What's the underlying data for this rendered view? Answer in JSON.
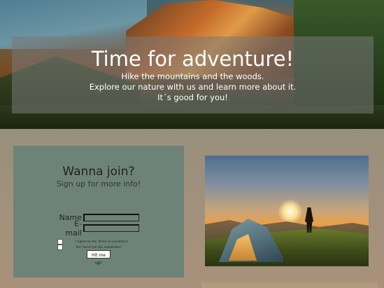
{
  "hero": {
    "title": "Time for adventure!",
    "lines": [
      "Hike the mountains and the woods.",
      "Explore our nature with us and learn more about it.",
      "It´s good for you!"
    ]
  },
  "join": {
    "title": "Wanna join?",
    "subtitle": "Sign up for more info!",
    "name_label": "Name",
    "email_label": "E-mail",
    "name_value": "",
    "email_value": "",
    "terms_label": "I agree to the Terms & Conditions",
    "newsletter_label": "Yes! Send me the newsletter!",
    "submit_label": "Hit me up!"
  },
  "colors": {
    "panel": "#6e8378",
    "overlay": "rgba(120,120,120,0.55)"
  },
  "icons": {
    "hero_image": "mountain-coast-photo",
    "side_image": "tent-sunset-photo"
  }
}
